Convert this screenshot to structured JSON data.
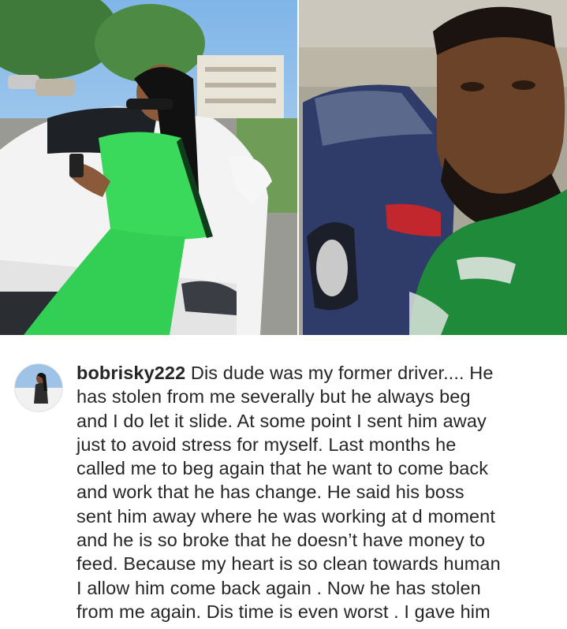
{
  "post": {
    "username": "bobrisky222",
    "caption_lines": [
      "Dis dude was my former driver.... He",
      "has stolen from me severally but he always beg",
      "and I do let it slide. At some point I sent him away",
      "just to avoid stress for myself.  Last months he",
      "called me to beg again that he want to come back",
      "and work that he has change. He said his boss",
      "sent him away where he was working at d moment",
      "and he is so broke that he doesn’t have money to",
      "feed. Because my heart is so clean towards human",
      "I allow him come back again . Now he has stolen",
      "from me again. Dis time is even worst . I gave him"
    ]
  },
  "colors": {
    "text": "#262626",
    "outfit_green": "#39d65a",
    "jersey_green": "#1f8a3a",
    "car_white": "#f2f2f2",
    "car_blue": "#2c3a66"
  }
}
